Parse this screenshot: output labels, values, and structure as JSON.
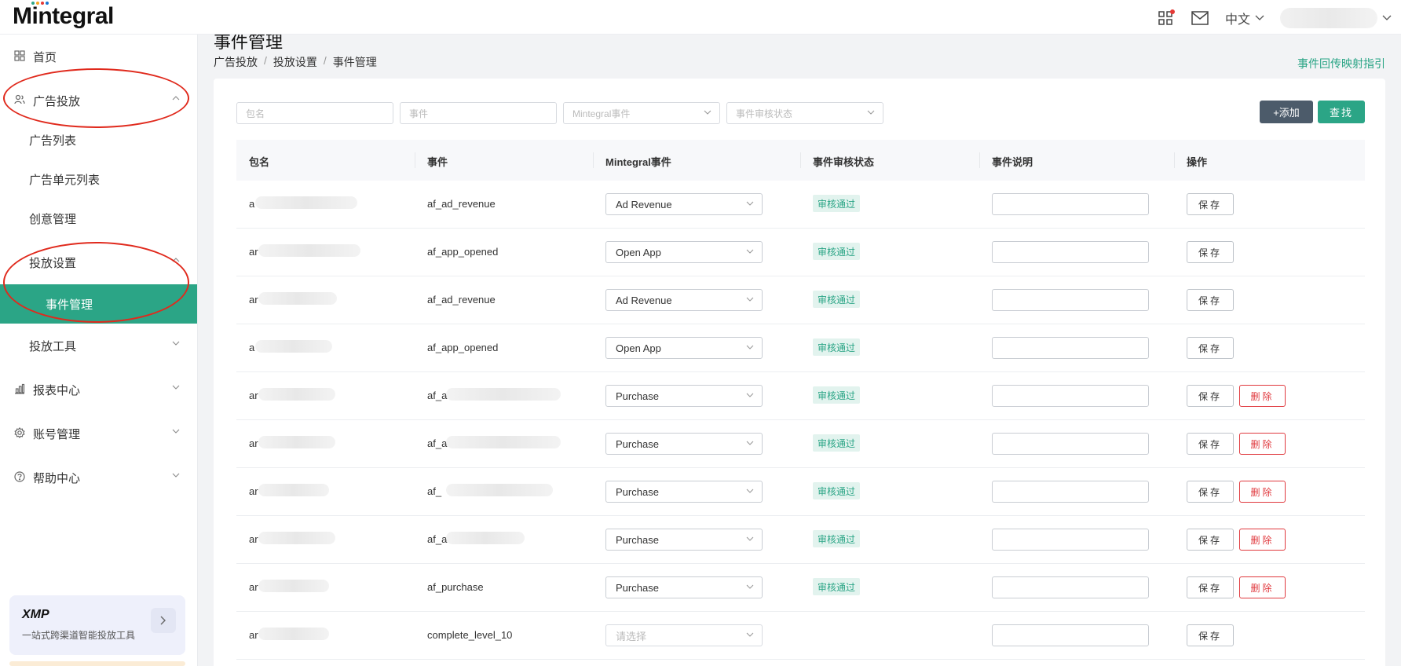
{
  "app": {
    "logo_text": "Mintegral",
    "logo_dot_colors": [
      "#2ba586",
      "#f5a623",
      "#e53935",
      "#1976d2"
    ],
    "language": "中文",
    "accent_color": "#2ba586"
  },
  "sidebar": {
    "items": [
      {
        "label": "首页",
        "icon": "grid-icon"
      },
      {
        "label": "广告投放",
        "icon": "users-icon",
        "expanded": true
      },
      {
        "label": "广告列表"
      },
      {
        "label": "广告单元列表"
      },
      {
        "label": "创意管理"
      },
      {
        "label": "投放设置",
        "expanded": true
      },
      {
        "label": "事件管理",
        "active": true
      },
      {
        "label": "投放工具"
      },
      {
        "label": "报表中心",
        "icon": "chart-icon"
      },
      {
        "label": "账号管理",
        "icon": "gear-icon"
      },
      {
        "label": "帮助中心",
        "icon": "help-icon"
      }
    ],
    "promo": {
      "logo": "XMP",
      "text": "一站式跨渠道智能投放工具"
    }
  },
  "main": {
    "title": "事件管理",
    "breadcrumb": [
      "广告投放",
      "投放设置",
      "事件管理"
    ],
    "guide_link": "事件回传映射指引"
  },
  "filters": {
    "package_placeholder": "包名",
    "event_placeholder": "事件",
    "mintegral_event_placeholder": "Mintegral事件",
    "status_placeholder": "事件审核状态",
    "add_label": "+添加",
    "search_label": "查找"
  },
  "table": {
    "headers": [
      "包名",
      "事件",
      "Mintegral事件",
      "事件审核状态",
      "事件说明",
      "操作"
    ],
    "save_label": "保存",
    "delete_label": "删除",
    "rows": [
      {
        "pkg_prefix": "a",
        "event": "af_ad_revenue",
        "mintegral_event": "Ad Revenue",
        "status": "审核通过",
        "deletable": false
      },
      {
        "pkg_prefix": "ar",
        "event": "af_app_opened",
        "mintegral_event": "Open App",
        "status": "审核通过",
        "deletable": false
      },
      {
        "pkg_prefix": "ar",
        "event": "af_ad_revenue",
        "mintegral_event": "Ad Revenue",
        "status": "审核通过",
        "deletable": false
      },
      {
        "pkg_prefix": "a",
        "event": "af_app_opened",
        "mintegral_event": "Open App",
        "status": "审核通过",
        "deletable": false
      },
      {
        "pkg_prefix": "ar",
        "event": "af_a",
        "mintegral_event": "Purchase",
        "status": "审核通过",
        "deletable": true
      },
      {
        "pkg_prefix": "ar",
        "event": "af_a",
        "mintegral_event": "Purchase",
        "status": "审核通过",
        "deletable": true
      },
      {
        "pkg_prefix": "ar",
        "event": "af_",
        "mintegral_event": "Purchase",
        "status": "审核通过",
        "deletable": true
      },
      {
        "pkg_prefix": "ar",
        "event": "af_a",
        "mintegral_event": "Purchase",
        "status": "审核通过",
        "deletable": true
      },
      {
        "pkg_prefix": "ar",
        "event": "af_purchase",
        "mintegral_event": "Purchase",
        "status": "审核通过",
        "deletable": true
      },
      {
        "pkg_prefix": "ar",
        "event": "complete_level_10",
        "mintegral_event": "",
        "mintegral_event_placeholder": "请选择",
        "status": "",
        "deletable": false
      }
    ]
  }
}
